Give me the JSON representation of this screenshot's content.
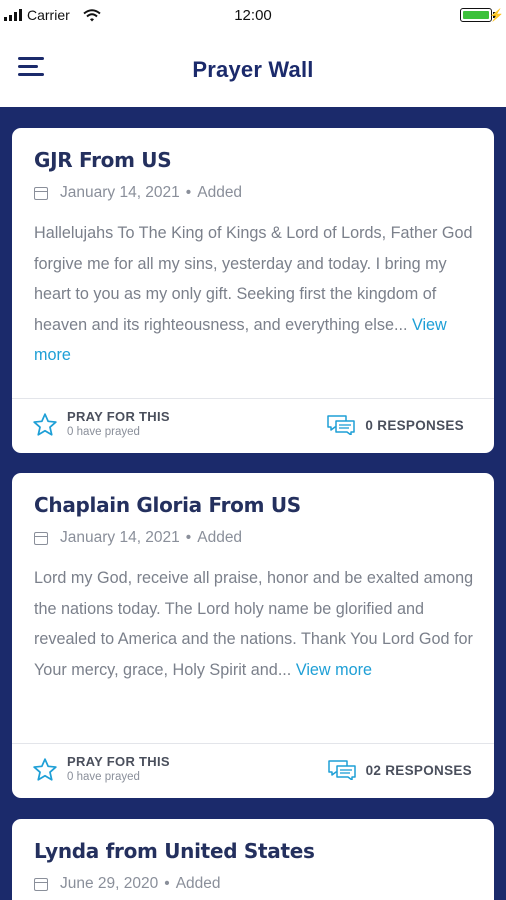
{
  "status_bar": {
    "carrier": "Carrier",
    "time": "12:00"
  },
  "header": {
    "title": "Prayer Wall",
    "menu_icon": "hamburger-menu-icon"
  },
  "colors": {
    "brand": "#1b2a6b",
    "link": "#1e9fd6",
    "battery": "#3cc13b"
  },
  "posts": [
    {
      "title": "GJR From US",
      "date": "January 14, 2021",
      "status": "Added",
      "body": "Hallelujahs To The King of Kings & Lord of Lords, Father God forgive me for all my sins, yesterday and today. I bring my heart to you as my only gift. Seeking first the kingdom of heaven and its righteousness, and everything else...",
      "view_more": "View more",
      "pray_label": "PRAY FOR THIS",
      "pray_count": "0 have prayed",
      "responses": "0 RESPONSES"
    },
    {
      "title": "Chaplain Gloria From US",
      "date": "January 14, 2021",
      "status": "Added",
      "body": "Lord my God, receive all praise, honor and be exalted among the nations today. The Lord holy name be glorified and revealed to America and the nations. Thank You Lord God for Your mercy, grace, Holy Spirit and...",
      "view_more": "View more",
      "pray_label": "PRAY FOR THIS",
      "pray_count": "0 have prayed",
      "responses": "02 RESPONSES"
    },
    {
      "title": "Lynda from United States",
      "date": "June 29, 2020",
      "status": "Added"
    }
  ]
}
